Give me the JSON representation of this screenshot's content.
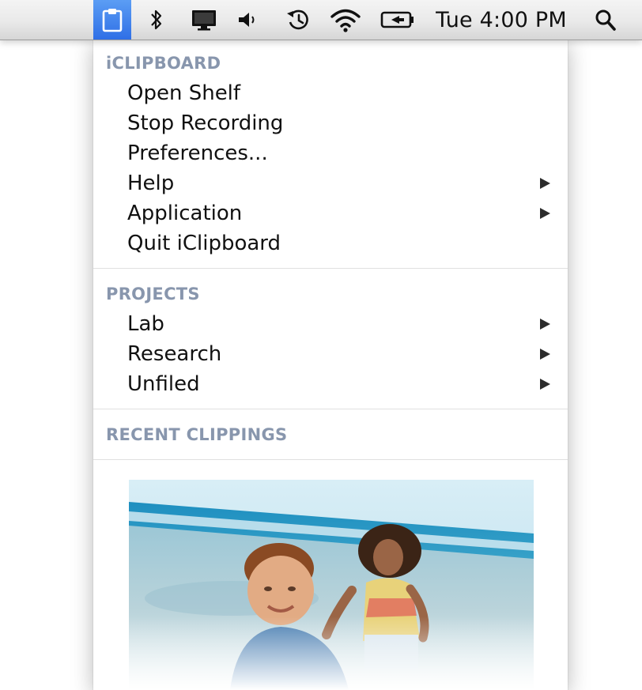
{
  "menubar": {
    "active_icon": "iclipboard-icon",
    "icons": [
      "bluetooth-icon",
      "display-icon",
      "volume-icon",
      "time-machine-icon",
      "wifi-icon",
      "battery-icon",
      "spotlight-search-icon"
    ],
    "clock": "Tue 4:00 PM",
    "active_color": "#3a7cf0"
  },
  "menu": {
    "app_section": {
      "header": "iCLIPBOARD",
      "items": [
        {
          "label": "Open Shelf",
          "submenu": false
        },
        {
          "label": "Stop Recording",
          "submenu": false
        },
        {
          "label": "Preferences...",
          "submenu": false
        },
        {
          "label": "Help",
          "submenu": true
        },
        {
          "label": "Application",
          "submenu": true
        },
        {
          "label": "Quit iClipboard",
          "submenu": false
        }
      ]
    },
    "projects_section": {
      "header": "PROJECTS",
      "items": [
        {
          "label": "Lab",
          "submenu": true
        },
        {
          "label": "Research",
          "submenu": true
        },
        {
          "label": "Unfiled",
          "submenu": true
        }
      ]
    },
    "recent_section": {
      "header": "RECENT CLIPPINGS",
      "thumbnail": "beach-photo-thumbnail"
    },
    "header_color": "#8896ad"
  }
}
